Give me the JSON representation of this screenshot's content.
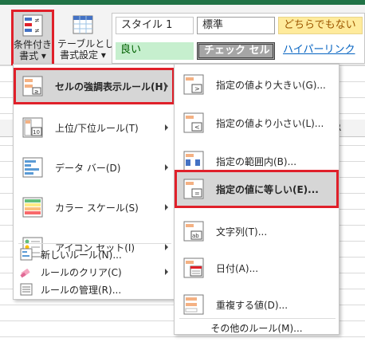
{
  "ribbon": {
    "conditional_format": {
      "line1": "条件付き",
      "line2": "書式"
    },
    "format_as_table": {
      "line1": "テーブルとして",
      "line2": "書式設定"
    },
    "styles": {
      "style1": "スタイル 1",
      "normal": "標準",
      "neutral": "どちらでもない",
      "good": "良い",
      "check_cell": "チェック セル",
      "hyperlink": "ハイパーリンク"
    }
  },
  "grid": {
    "column_letter": "R"
  },
  "main_menu": {
    "items": [
      {
        "label": "セルの強調表示ルール(H)",
        "icon": "highlight-rules-icon"
      },
      {
        "label": "上位/下位ルール(T)",
        "icon": "top-bottom-rules-icon"
      },
      {
        "label": "データ バー(D)",
        "icon": "data-bars-icon"
      },
      {
        "label": "カラー スケール(S)",
        "icon": "color-scales-icon"
      },
      {
        "label": "アイコン セット(I)",
        "icon": "icon-sets-icon"
      }
    ],
    "small_items": [
      {
        "label": "新しいルール(N)...",
        "icon": "new-rule-icon"
      },
      {
        "label": "ルールのクリア(C)",
        "icon": "clear-rules-icon"
      },
      {
        "label": "ルールの管理(R)...",
        "icon": "manage-rules-icon"
      }
    ]
  },
  "sub_menu": {
    "items": [
      {
        "label": "指定の値より大きい(G)...",
        "icon": "greater-than-icon"
      },
      {
        "label": "指定の値より小さい(L)...",
        "icon": "less-than-icon"
      },
      {
        "label": "指定の範囲内(B)...",
        "icon": "between-icon"
      },
      {
        "label": "指定の値に等しい(E)...",
        "icon": "equal-to-icon"
      },
      {
        "label": "文字列(T)...",
        "icon": "text-contains-icon"
      },
      {
        "label": "日付(A)...",
        "icon": "date-occurring-icon"
      },
      {
        "label": "重複する値(D)...",
        "icon": "duplicate-values-icon"
      }
    ],
    "more": "その他のルール(M)..."
  },
  "colors": {
    "highlight_border": "#e0202a",
    "excel_green": "#217346",
    "good_fill": "#c6efce",
    "neutral_fill": "#ffeb9c"
  }
}
